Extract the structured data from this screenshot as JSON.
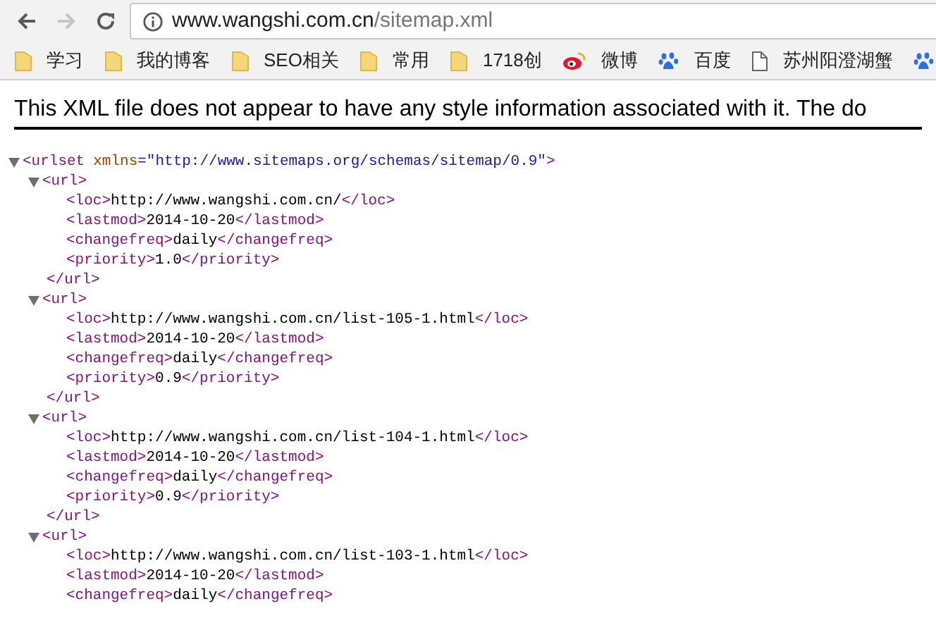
{
  "toolbar": {
    "back_disabled": false,
    "forward_disabled": true,
    "url_host": "www.wangshi.com.cn",
    "url_path": "/sitemap.xml"
  },
  "bookmarks": [
    {
      "kind": "folder",
      "label": "学习"
    },
    {
      "kind": "folder",
      "label": "我的博客"
    },
    {
      "kind": "folder",
      "label": "SEO相关"
    },
    {
      "kind": "folder",
      "label": "常用"
    },
    {
      "kind": "folder",
      "label": "1718创"
    },
    {
      "kind": "weibo",
      "label": "微博"
    },
    {
      "kind": "paw",
      "label": "百度"
    },
    {
      "kind": "page",
      "label": "苏州阳澄湖蟹"
    },
    {
      "kind": "paw"
    }
  ],
  "notice": "This XML file does not appear to have any style information associated with it. The do",
  "xml": {
    "open": "<urlset",
    "attr_name": "xmlns",
    "attr_value": "=\"http://www.sitemaps.org/schemas/sitemap/0.9\"",
    "open_end": ">",
    "expanded": true,
    "children": [
      {
        "open": "<url>",
        "expanded": true,
        "close": "</url>",
        "children": [
          {
            "open": "<loc>",
            "text": "http://www.wangshi.com.cn/",
            "close": "</loc>"
          },
          {
            "open": "<lastmod>",
            "text": "2014-10-20",
            "close": "</lastmod>"
          },
          {
            "open": "<changefreq>",
            "text": "daily",
            "close": "</changefreq>"
          },
          {
            "open": "<priority>",
            "text": "1.0",
            "close": "</priority>"
          }
        ]
      },
      {
        "open": "<url>",
        "expanded": true,
        "close": "</url>",
        "children": [
          {
            "open": "<loc>",
            "text": "http://www.wangshi.com.cn/list-105-1.html",
            "close": "</loc>"
          },
          {
            "open": "<lastmod>",
            "text": "2014-10-20",
            "close": "</lastmod>"
          },
          {
            "open": "<changefreq>",
            "text": "daily",
            "close": "</changefreq>"
          },
          {
            "open": "<priority>",
            "text": "0.9",
            "close": "</priority>"
          }
        ]
      },
      {
        "open": "<url>",
        "expanded": true,
        "close": "</url>",
        "children": [
          {
            "open": "<loc>",
            "text": "http://www.wangshi.com.cn/list-104-1.html",
            "close": "</loc>"
          },
          {
            "open": "<lastmod>",
            "text": "2014-10-20",
            "close": "</lastmod>"
          },
          {
            "open": "<changefreq>",
            "text": "daily",
            "close": "</changefreq>"
          },
          {
            "open": "<priority>",
            "text": "0.9",
            "close": "</priority>"
          }
        ]
      },
      {
        "open": "<url>",
        "expanded": true,
        "children": [
          {
            "open": "<loc>",
            "text": "http://www.wangshi.com.cn/list-103-1.html",
            "close": "</loc>"
          },
          {
            "open": "<lastmod>",
            "text": "2014-10-20",
            "close": "</lastmod>"
          },
          {
            "open": "<changefreq>",
            "text": "daily",
            "close": "</changefreq>"
          }
        ]
      }
    ]
  }
}
